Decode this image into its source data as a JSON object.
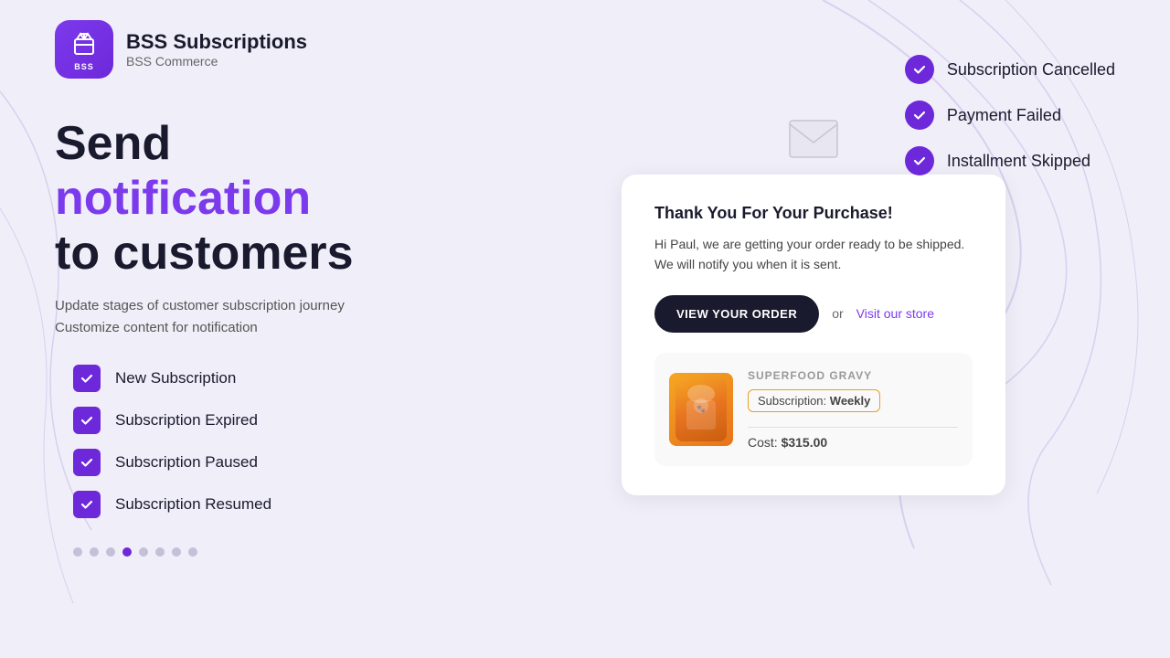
{
  "brand": {
    "name": "BSS Subscriptions",
    "sub": "BSS Commerce",
    "logo_short": "BSS"
  },
  "top_notifications": [
    {
      "id": "notif-cancelled",
      "label": "Subscription Cancelled"
    },
    {
      "id": "notif-payment",
      "label": "Payment Failed"
    },
    {
      "id": "notif-installment",
      "label": "Installment Skipped"
    }
  ],
  "hero": {
    "line1": "Send",
    "line2": "notification",
    "line3": "to customers",
    "subtitle_line1": "Update stages of customer subscription journey",
    "subtitle_line2": "Customize content for notification"
  },
  "checklist": [
    {
      "label": "New Subscription"
    },
    {
      "label": "Subscription Expired"
    },
    {
      "label": "Subscription Paused"
    },
    {
      "label": "Subscription Resumed"
    }
  ],
  "dots": {
    "total": 8,
    "active_index": 3
  },
  "email_preview": {
    "title": "Thank You For Your Purchase!",
    "body": "Hi Paul, we are getting your order ready to be shipped. We will notify you when it is sent.",
    "btn_label": "VIEW YOUR ORDER",
    "or_text": "or",
    "visit_label": "Visit our store"
  },
  "product": {
    "name": "SUPERFOOD GRAVY",
    "badge_prefix": "Subscription:",
    "badge_value": "Weekly",
    "cost_prefix": "Cost:",
    "cost_value": "$315.00"
  },
  "colors": {
    "purple": "#7c3aed",
    "dark": "#1a1a2e",
    "accent_orange": "#e8a020"
  }
}
